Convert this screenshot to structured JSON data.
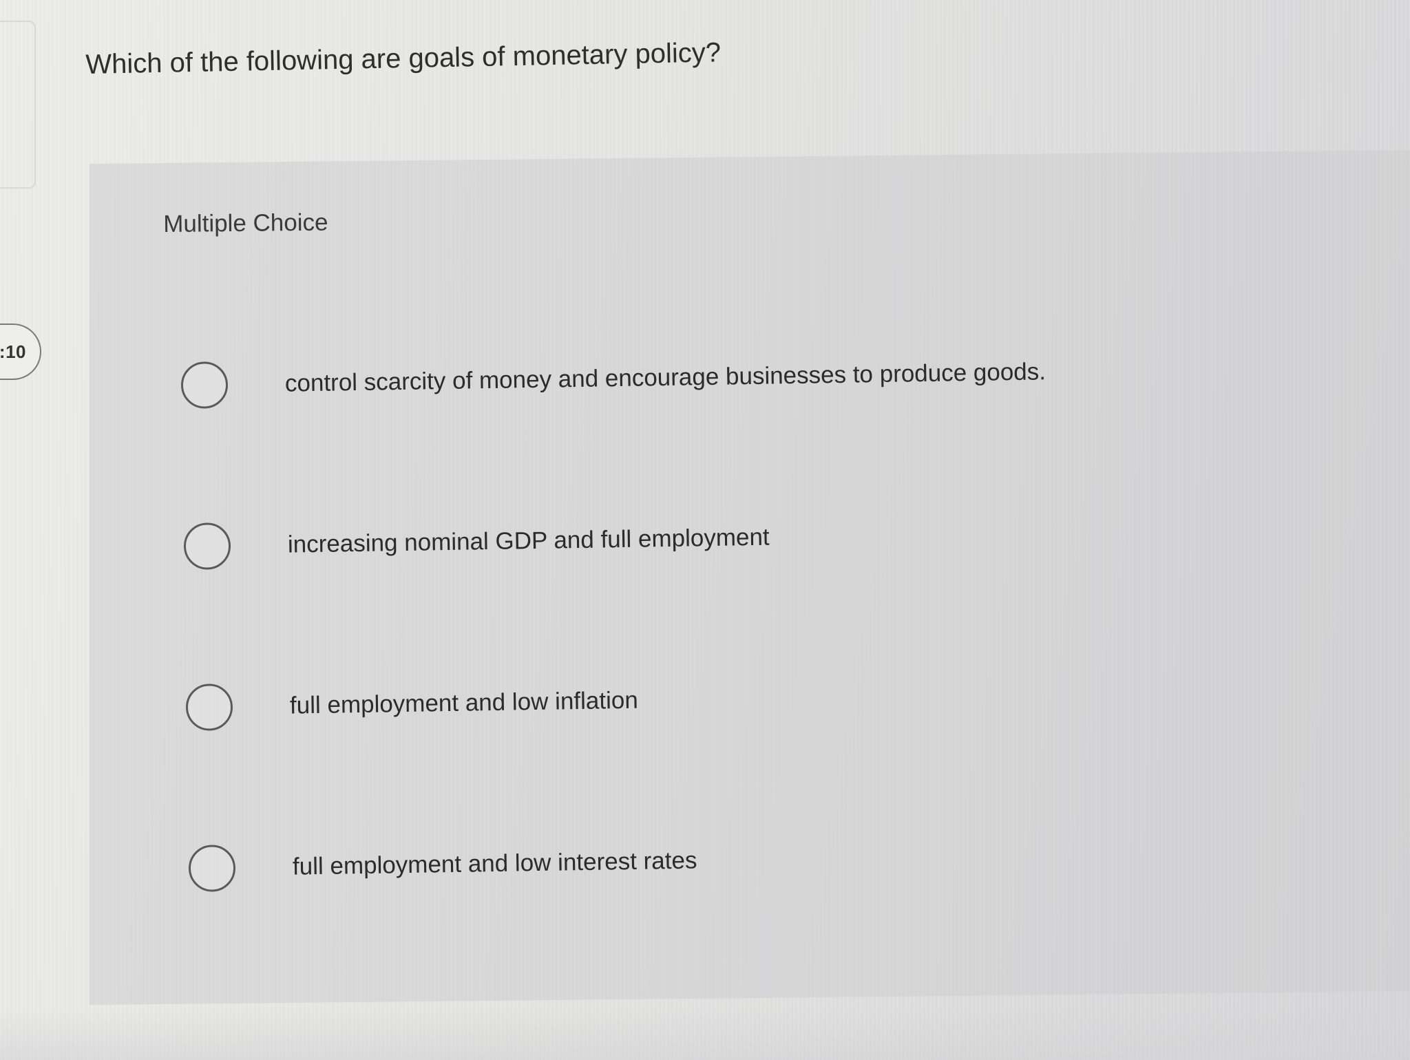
{
  "timer": {
    "display": ":10"
  },
  "question": {
    "text": "Which of the following are goals of monetary policy?"
  },
  "question_type": {
    "label": "Multiple Choice"
  },
  "options": [
    {
      "label": "control scarcity of money and encourage businesses to produce goods.",
      "selected": false
    },
    {
      "label": "increasing nominal GDP and full employment",
      "selected": false
    },
    {
      "label": "full employment and low inflation",
      "selected": false
    },
    {
      "label": "full employment and low interest rates",
      "selected": false
    }
  ]
}
